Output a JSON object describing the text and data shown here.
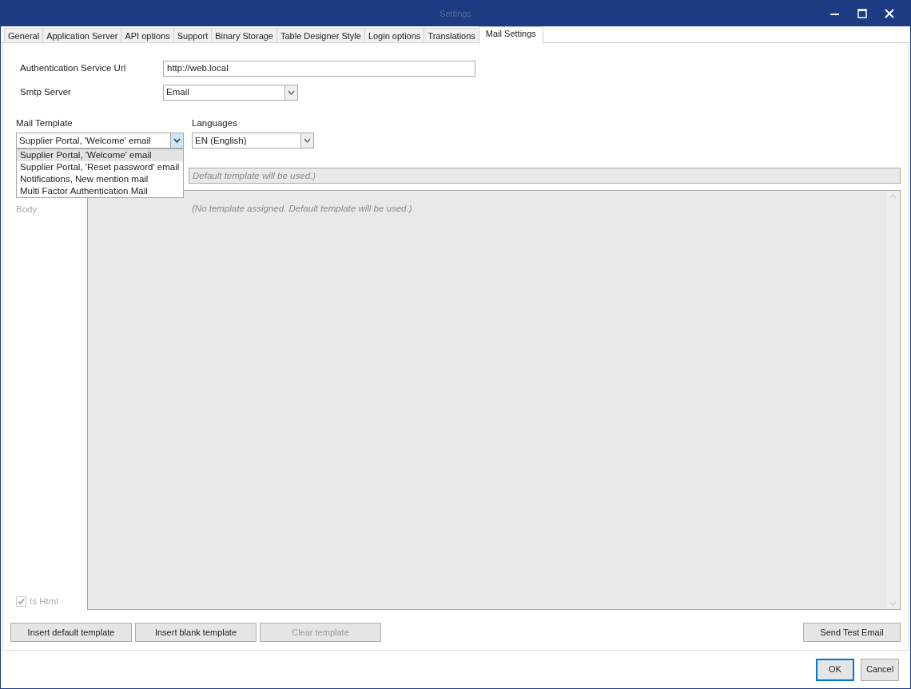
{
  "window": {
    "title": "Settings"
  },
  "tabs": [
    {
      "label": "General",
      "selected": false
    },
    {
      "label": "Application Server",
      "selected": false
    },
    {
      "label": "API options",
      "selected": false
    },
    {
      "label": "Support",
      "selected": false
    },
    {
      "label": "Binary Storage",
      "selected": false
    },
    {
      "label": "Table Designer Style",
      "selected": false
    },
    {
      "label": "Login options",
      "selected": false
    },
    {
      "label": "Translations",
      "selected": false
    },
    {
      "label": "Mail Settings",
      "selected": true
    }
  ],
  "auth_url": {
    "label": "Authentication Service Url",
    "value": "http://web.local"
  },
  "smtp_server": {
    "label": "Smtp Server",
    "value": "Email"
  },
  "mail_template": {
    "label": "Mail Template",
    "value": "Supplier Portal, 'Welcome' email",
    "expanded": true,
    "options": [
      {
        "label": "Supplier Portal, 'Welcome' email",
        "selected": true
      },
      {
        "label": "Supplier Portal, 'Reset password' email",
        "selected": false
      },
      {
        "label": "Notifications, New mention mail",
        "selected": false
      },
      {
        "label": "Multi Factor Authentication Mail",
        "selected": false
      }
    ]
  },
  "languages": {
    "label": "Languages",
    "value": "EN (English)"
  },
  "subject": {
    "placeholder": "Default template will be used.)"
  },
  "body": {
    "label": "Body",
    "placeholder": "(No template assigned. Default template will be used.)"
  },
  "is_html": {
    "label": "Is Html",
    "checked": true,
    "disabled": true
  },
  "template_buttons": [
    {
      "label": "Insert default template",
      "disabled": false
    },
    {
      "label": "Insert blank template",
      "disabled": false
    },
    {
      "label": "Clear template",
      "disabled": true
    }
  ],
  "send_test_button": {
    "label": "Send Test Email"
  },
  "dialog_buttons": [
    {
      "label": "OK",
      "default": true
    },
    {
      "label": "Cancel",
      "default": false
    }
  ]
}
